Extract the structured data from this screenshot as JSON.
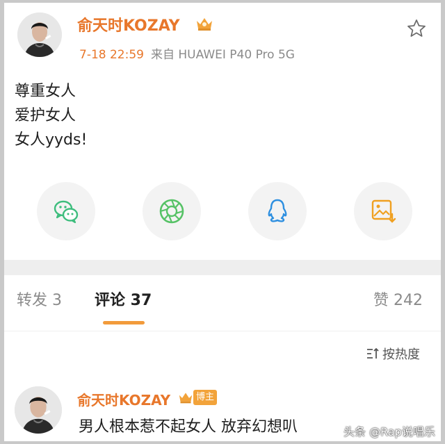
{
  "post": {
    "author": "俞天时KOZAY",
    "time": "7-18 22:59",
    "source": "来自 HUAWEI P40 Pro 5G",
    "lines": [
      "尊重女人",
      "爱护女人",
      "女人yyds!"
    ],
    "share_icons": [
      "wechat-icon",
      "moments-icon",
      "qq-icon",
      "save-image-icon"
    ]
  },
  "tabs": {
    "repost": "转发 3",
    "comments": "评论 37",
    "likes": "赞 242"
  },
  "sort": {
    "label": "按热度"
  },
  "comment": {
    "author": "俞天时KOZAY",
    "badge": "博主",
    "text": "男人根本惹不起女人 放弃幻想叭"
  },
  "watermark": "头条 @Rap说唱乐",
  "colors": {
    "name": "#e8772b",
    "accent_underline": "#f29b3b",
    "wechat": "#3dbd7d",
    "moments": "#56c266",
    "qq": "#2d8fe0",
    "save": "#f0a020"
  }
}
